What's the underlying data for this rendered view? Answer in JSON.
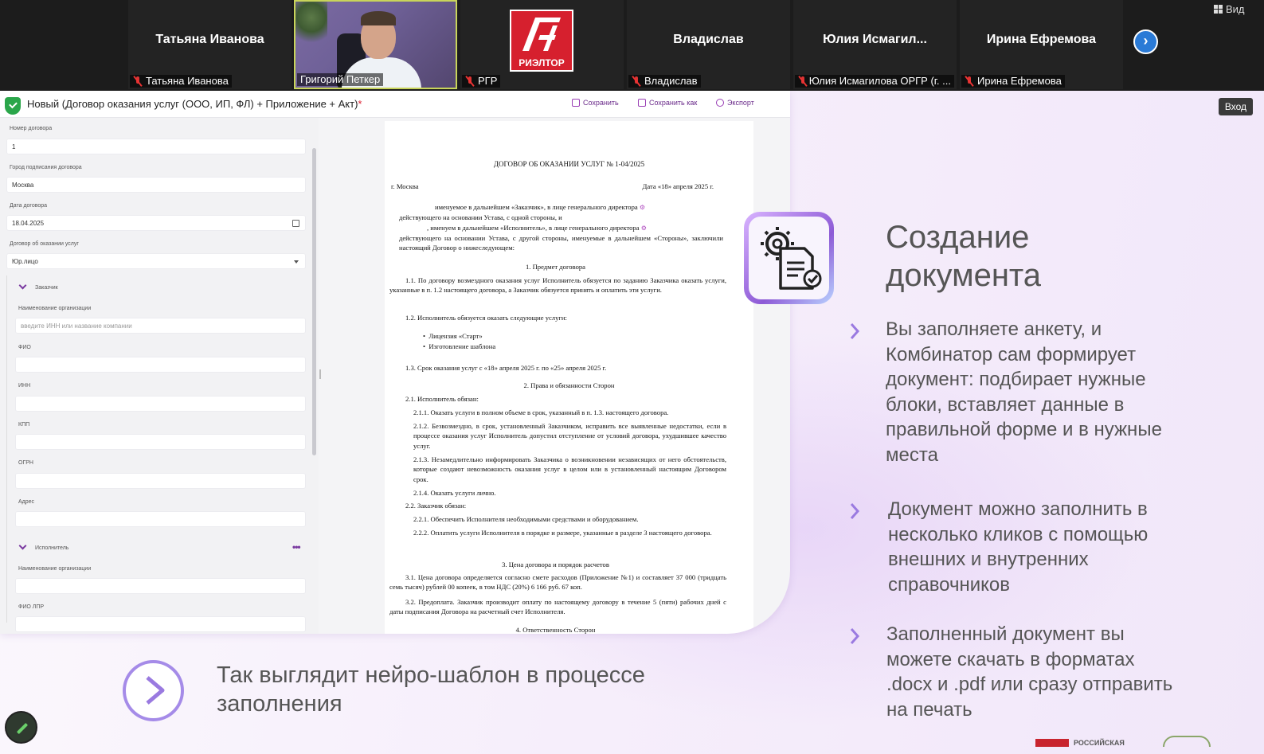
{
  "top_right": {
    "view_label": "Вид"
  },
  "participants": [
    {
      "name_big": "Татьяна Иванова",
      "label": "Татьяна Иванова"
    },
    {
      "label": "Григорий Петкер"
    },
    {
      "label": "РГР",
      "logo_text": "РИЭЛТОР"
    },
    {
      "name_big": "Владислав",
      "label": "Владислав"
    },
    {
      "name_big": "Юлия Исмагил...",
      "label": "Юлия Исмагилова ОРГР (г. ..."
    },
    {
      "name_big": "Ирина Ефремова",
      "label": "Ирина Ефремова"
    }
  ],
  "next_icon": "›",
  "login_label": "Вход",
  "app": {
    "title": "Новый (Договор оказания услуг (ООО, ИП, ФЛ) + Приложение + Акт)",
    "unsaved_mark": "*",
    "toolbar": {
      "save": "Сохранить",
      "save_as": "Сохранить как",
      "export": "Экспорт"
    },
    "form": {
      "contract_number_label": "Номер договора",
      "contract_number_value": "1",
      "city_label": "Город подписания договора",
      "city_value": "Москва",
      "date_label": "Дата договора",
      "date_value": "18.04.2025",
      "type_label": "Договор об оказании услуг",
      "type_value": "Юр.лицо",
      "customer_section": "Заказчик",
      "org_name_label": "Наименование организации",
      "org_name_placeholder": "введите ИНН или название компании",
      "fio_label": "ФИО",
      "inn_label": "ИНН",
      "kpp_label": "КПП",
      "ogrn_label": "ОГРН",
      "address_label": "Адрес",
      "executor_section": "Исполнитель",
      "executor_org_label": "Наименование организации",
      "executor_fio_label": "ФИО ЛПР",
      "dots": "•••"
    },
    "doc": {
      "title": "ДОГОВОР ОБ ОКАЗАНИИ УСЛУГ № 1-04/2025",
      "city": "г. Москва",
      "date": "Дата «18» апреля 2025 г.",
      "p1": "именуемое в дальнейшем «Заказчик», в лице генерального директора",
      "p1b": "действующего на основании Устава, с одной стороны, и",
      "p2": ", именуем в дальнейшем «Исполнитель», в лице генерального директора",
      "p2b": "действующего на основании Устава, с другой стороны, именуемые в дальнейшем «Стороны», заключили настоящий Договор о нижеследующем:",
      "s1": "1.   Предмет договора",
      "s1_1": "1.1. По договору возмездного оказания услуг Исполнитель обязуется по заданию Заказчика оказать услуги, указанные в п. 1.2 настоящего договора, а Заказчик обязуется принять и оплатить эти услуги.",
      "s1_2": "1.2. Исполнитель обязуется оказать следующие услуги:",
      "li1": "Лицензия «Старт»",
      "li2": "Изготовление шаблона",
      "s1_3": "1.3. Срок оказания услуг с «18» апреля 2025 г. по «25» апреля 2025 г.",
      "s2": "2.   Права и обязанности Сторон",
      "s2_1": "2.1. Исполнитель обязан:",
      "s2_1_1": "2.1.1. Оказать услуги в полном объеме в срок, указанный в п. 1.3. настоящего договора.",
      "s2_1_2": "2.1.2. Безвозмездно, в срок, установленный Заказчиком, исправить все выявленные недостатки, если в процессе оказания услуг Исполнитель допустил отступление от условий договора, ухудшившее качество услуг.",
      "s2_1_3": "2.1.3. Незамедлительно информировать Заказчика о возникновении независящих от него обстоятельств, которые создают невозможность оказания услуг в целом или в установленный настоящим Договором срок.",
      "s2_1_4": "2.1.4. Оказать услуги лично.",
      "s2_2": "2.2. Заказчик обязан:",
      "s2_2_1": "2.2.1. Обеспечить Исполнителя необходимыми средствами и оборудованием.",
      "s2_2_2": "2.2.2. Оплатить услуги Исполнителя в порядке и размере, указанные в разделе 3 настоящего договора.",
      "s3": "3.   Цена договора и порядок расчетов",
      "s3_1": "3.1. Цена договора определяется согласно смете расходов (Приложение №1) и составляет 37 000 (тридцать семь тысяч) рублей 00 копеек, в том НДС (20%)  6 166 руб. 67 коп.",
      "s3_2": "3.2. Предоплата. Заказчик производит оплату по настоящему договору в течение 5 (пяти) рабочих дней с даты подписания Договора на расчетный счет Исполнителя.",
      "s4": "4.   Ответственность Сторон"
    }
  },
  "panel": {
    "title_line1": "Создание",
    "title_line2": "документа",
    "bullet1": "Вы заполняете анкету, и Комбинатор сам формирует документ: подбирает нужные блоки, вставляет данные в правильной форме и в нужные места",
    "bullet2": "Документ можно заполнить в несколько кликов с помощью внешних и внутренних справочников",
    "bullet3": "Заполненный документ вы можете скачать в форматах .docx  и .pdf или сразу отправить на печать"
  },
  "caption": "Так выглядит нейро-шаблон в процессе заполнения",
  "brand_text": "РОССИЙСКАЯ",
  "colors": {
    "accent": "#7a3aa0",
    "brand_red": "#d6202e",
    "text_gray": "#555555"
  }
}
